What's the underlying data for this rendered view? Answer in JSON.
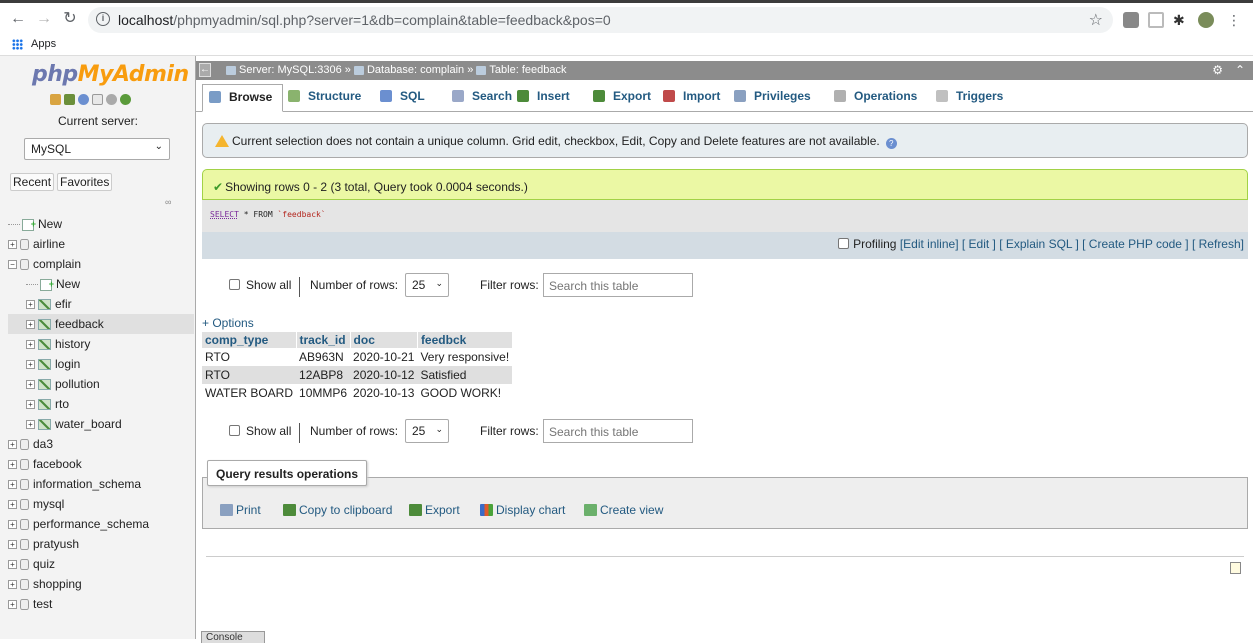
{
  "browser": {
    "url_host": "localhost",
    "url_path": "/phpmyadmin/sql.php?server=1&db=complain&table=feedback&pos=0",
    "bookmark_apps": "Apps"
  },
  "nav": {
    "logo_php": "php",
    "logo_myadmin": "MyAdmin",
    "current_server_label": "Current server:",
    "server_value": "MySQL",
    "recent": "Recent",
    "favorites": "Favorites",
    "tree": [
      {
        "label": "New",
        "level": 0,
        "kind": "new"
      },
      {
        "label": "airline",
        "level": 0,
        "kind": "db"
      },
      {
        "label": "complain",
        "level": 0,
        "kind": "db-open"
      },
      {
        "label": "New",
        "level": 1,
        "kind": "new"
      },
      {
        "label": "efir",
        "level": 1,
        "kind": "table"
      },
      {
        "label": "feedback",
        "level": 1,
        "kind": "table",
        "selected": true
      },
      {
        "label": "history",
        "level": 1,
        "kind": "table"
      },
      {
        "label": "login",
        "level": 1,
        "kind": "table"
      },
      {
        "label": "pollution",
        "level": 1,
        "kind": "table"
      },
      {
        "label": "rto",
        "level": 1,
        "kind": "table"
      },
      {
        "label": "water_board",
        "level": 1,
        "kind": "table"
      },
      {
        "label": "da3",
        "level": 0,
        "kind": "db"
      },
      {
        "label": "facebook",
        "level": 0,
        "kind": "db"
      },
      {
        "label": "information_schema",
        "level": 0,
        "kind": "db"
      },
      {
        "label": "mysql",
        "level": 0,
        "kind": "db"
      },
      {
        "label": "performance_schema",
        "level": 0,
        "kind": "db"
      },
      {
        "label": "pratyush",
        "level": 0,
        "kind": "db"
      },
      {
        "label": "quiz",
        "level": 0,
        "kind": "db"
      },
      {
        "label": "shopping",
        "level": 0,
        "kind": "db"
      },
      {
        "label": "test",
        "level": 0,
        "kind": "db"
      }
    ]
  },
  "topbar": {
    "server": "Server: MySQL:3306",
    "database": "Database: complain",
    "table": "Table: feedback"
  },
  "tabs": [
    {
      "label": "Browse",
      "icon": "browse-icon",
      "color": "#7a9cc6"
    },
    {
      "label": "Structure",
      "icon": "structure-icon",
      "color": "#8ab36e"
    },
    {
      "label": "SQL",
      "icon": "sql-icon",
      "color": "#6b8fd0"
    },
    {
      "label": "Search",
      "icon": "search-icon",
      "color": "#9aa8c8"
    },
    {
      "label": "Insert",
      "icon": "insert-icon",
      "color": "#4d8b3a"
    },
    {
      "label": "Export",
      "icon": "export-icon",
      "color": "#4d8b3a"
    },
    {
      "label": "Import",
      "icon": "import-icon",
      "color": "#c04a4a"
    },
    {
      "label": "Privileges",
      "icon": "privileges-icon",
      "color": "#8aa0c0"
    },
    {
      "label": "Operations",
      "icon": "operations-icon",
      "color": "#b0b0b0"
    },
    {
      "label": "Triggers",
      "icon": "triggers-icon",
      "color": "#c0c0c0"
    }
  ],
  "notice": "Current selection does not contain a unique column. Grid edit, checkbox, Edit, Copy and Delete features are not available.",
  "success": "Showing rows 0 - 2 (3 total, Query took 0.0004 seconds.)",
  "sql": {
    "kw1": "SELECT",
    "star": "*",
    "kw2": "FROM",
    "table": "`feedback`"
  },
  "profiling": {
    "label": "Profiling",
    "links": "[Edit inline] [ Edit ] [ Explain SQL ] [ Create PHP code ] [ Refresh]"
  },
  "rownav": {
    "show_all": "Show all",
    "num_rows_label": "Number of rows:",
    "num_rows_value": "25",
    "filter_label": "Filter rows:",
    "filter_placeholder": "Search this table"
  },
  "options_link": "+ Options",
  "table": {
    "columns": [
      "comp_type",
      "track_id",
      "doc",
      "feedbck"
    ],
    "rows": [
      [
        "RTO",
        "AB963N",
        "2020-10-21",
        "Very responsive!"
      ],
      [
        "RTO",
        "12ABP8",
        "2020-10-12",
        "Satisfied"
      ],
      [
        "WATER BOARD",
        "10MMP6",
        "2020-10-13",
        "GOOD WORK!"
      ]
    ]
  },
  "qro": {
    "legend": "Query results operations",
    "print": "Print",
    "copy": "Copy to clipboard",
    "export": "Export",
    "chart": "Display chart",
    "view": "Create view"
  },
  "console": "Console"
}
